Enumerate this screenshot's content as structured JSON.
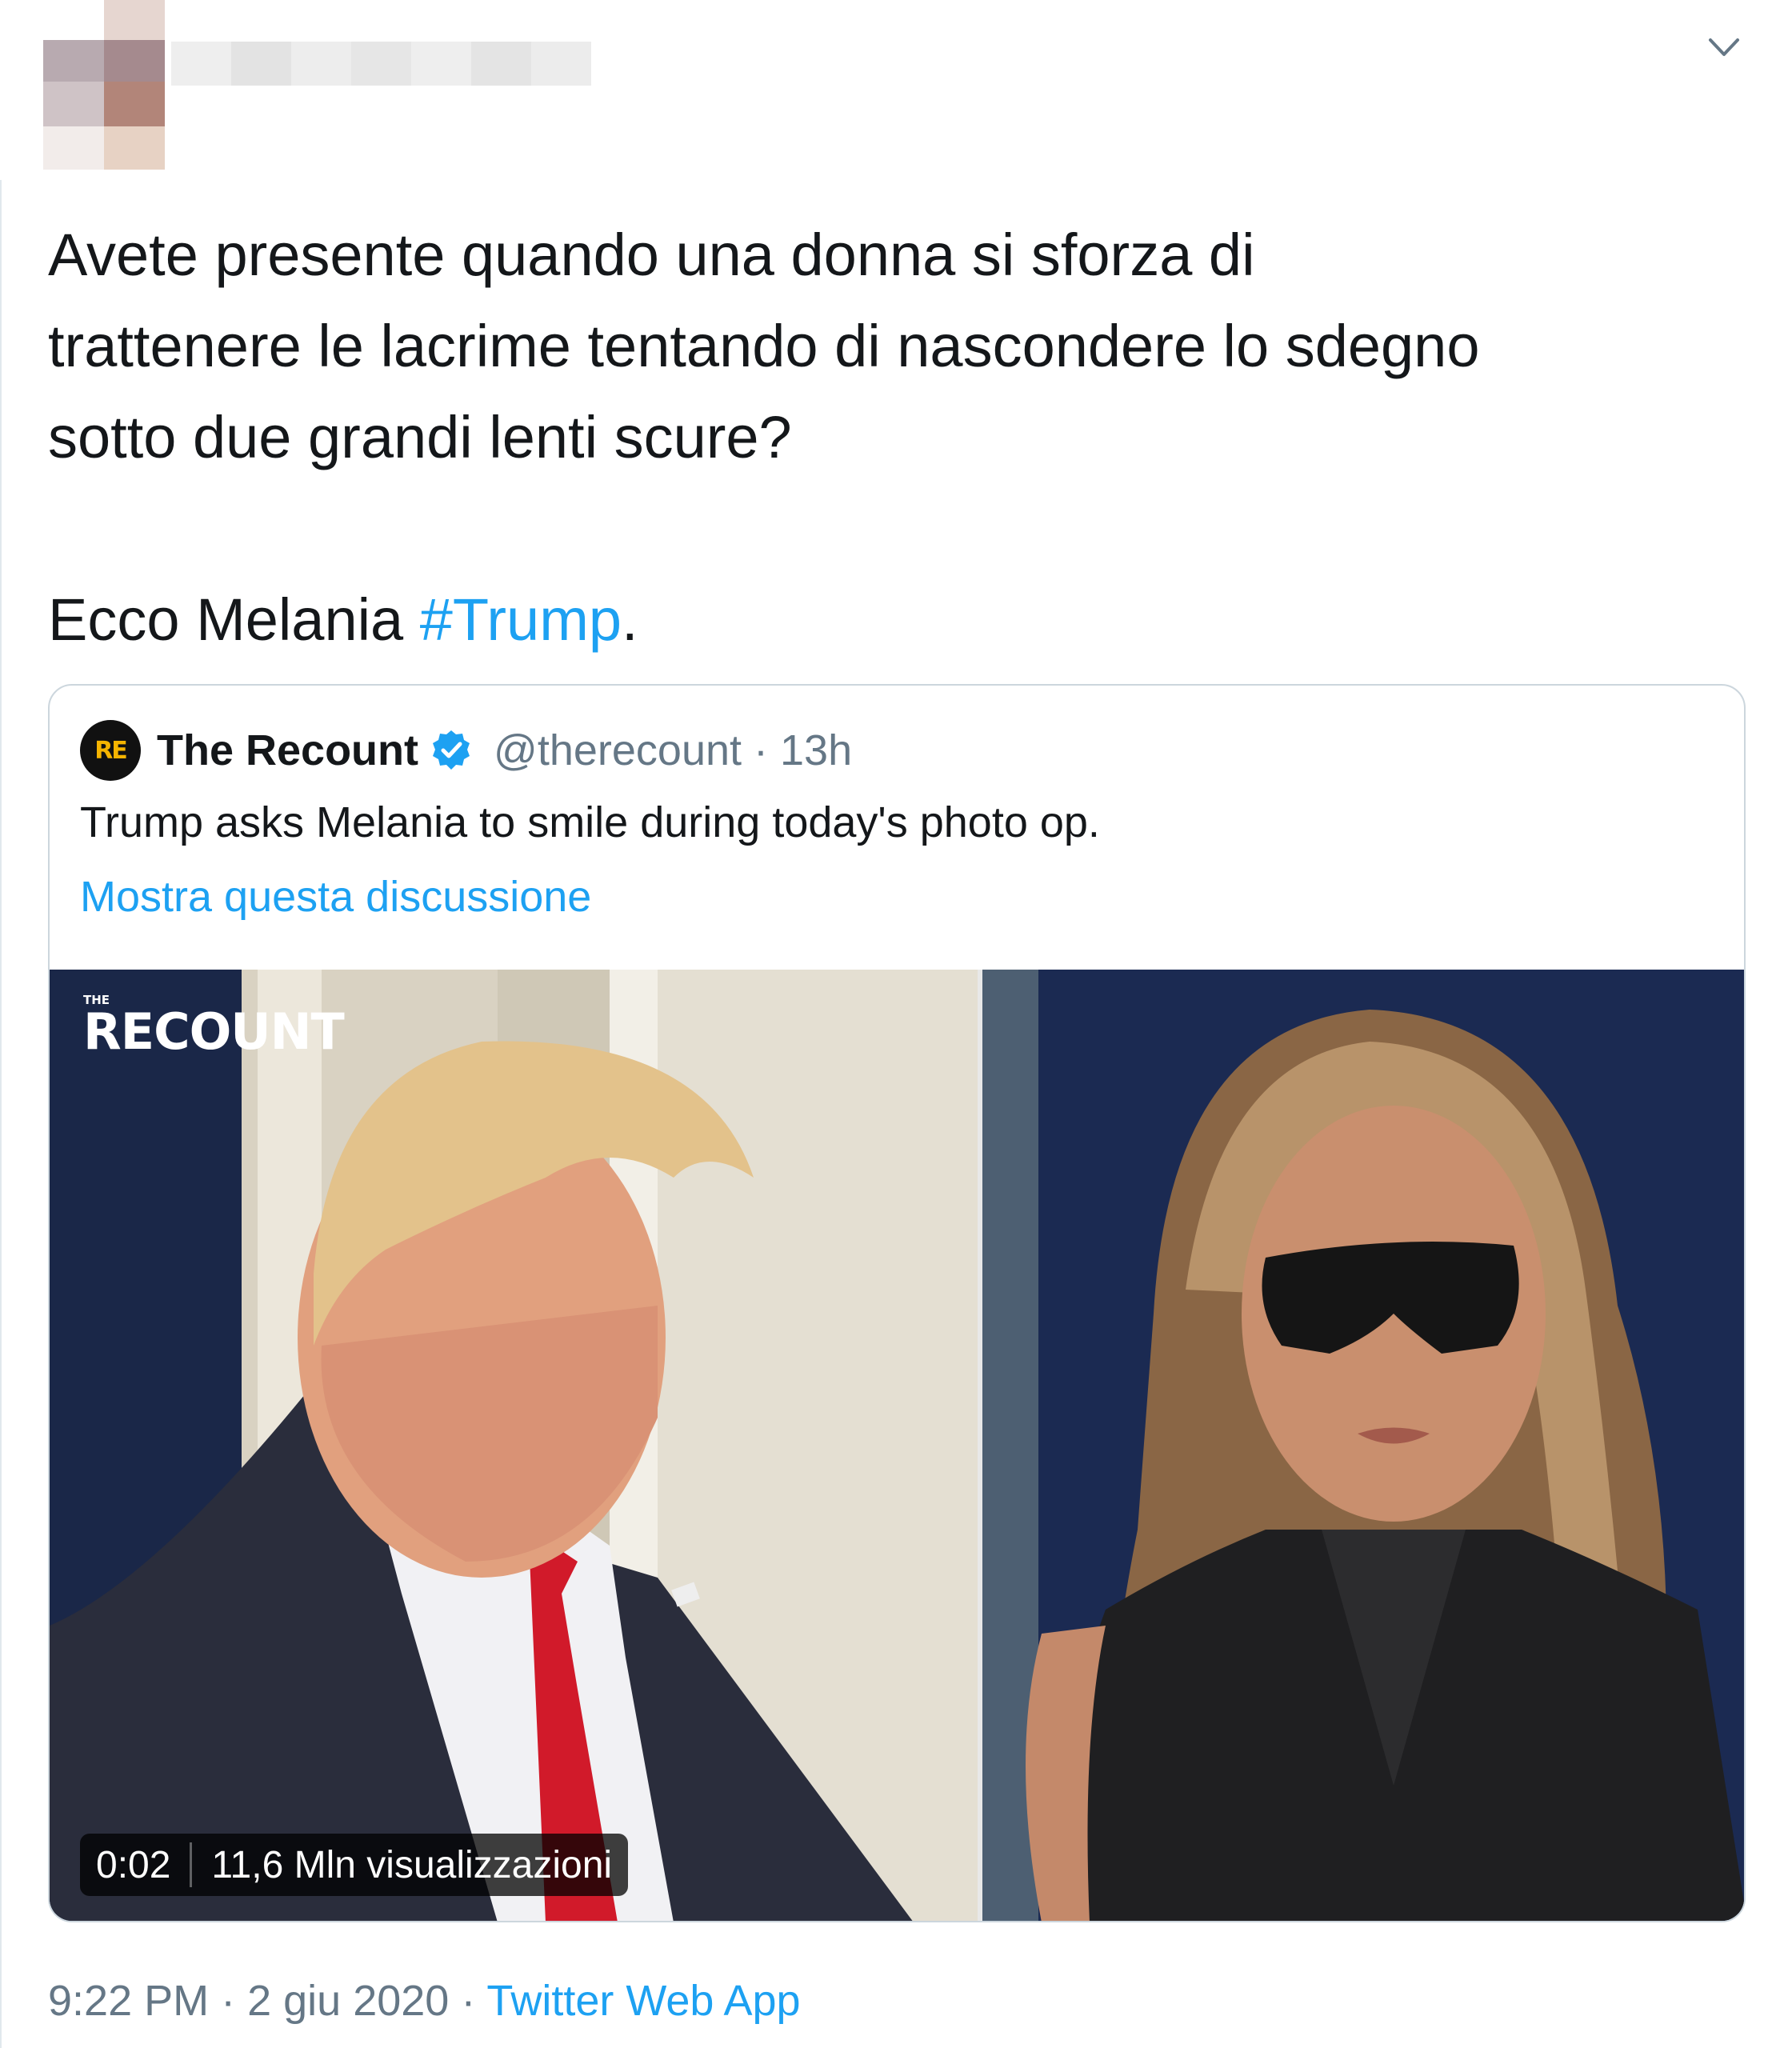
{
  "tweet": {
    "text_lines": [
      "Avete presente quando una donna si sforza di",
      "trattenere le lacrime tentando di nascondere lo sdegno",
      "sotto due grandi lenti scure?"
    ],
    "text_prefix": "Ecco Melania ",
    "hashtag": "#Trump",
    "text_suffix": ".",
    "time": "9:22 PM",
    "date": "2 giu 2020",
    "separator": " · ",
    "source": "Twitter Web App",
    "menu_icon": "chevron-down-icon"
  },
  "quoted": {
    "name": "The Recount",
    "logo_text": "RE",
    "handle": "@therecount",
    "age": "13h",
    "age_separator": " · ",
    "text": "Trump asks Melania to smile during today's photo op.",
    "show_thread": "Mostra questa discussione",
    "verified_icon": "verified-badge-icon",
    "video": {
      "watermark_small": "THE",
      "watermark_big": "RECOUNT",
      "duration": "0:02",
      "views": "11,6 Mln visualizzazioni"
    }
  },
  "colors": {
    "link": "#1da1f2",
    "text": "#14171a",
    "secondary": "#657786",
    "border": "#ccd6dd"
  }
}
